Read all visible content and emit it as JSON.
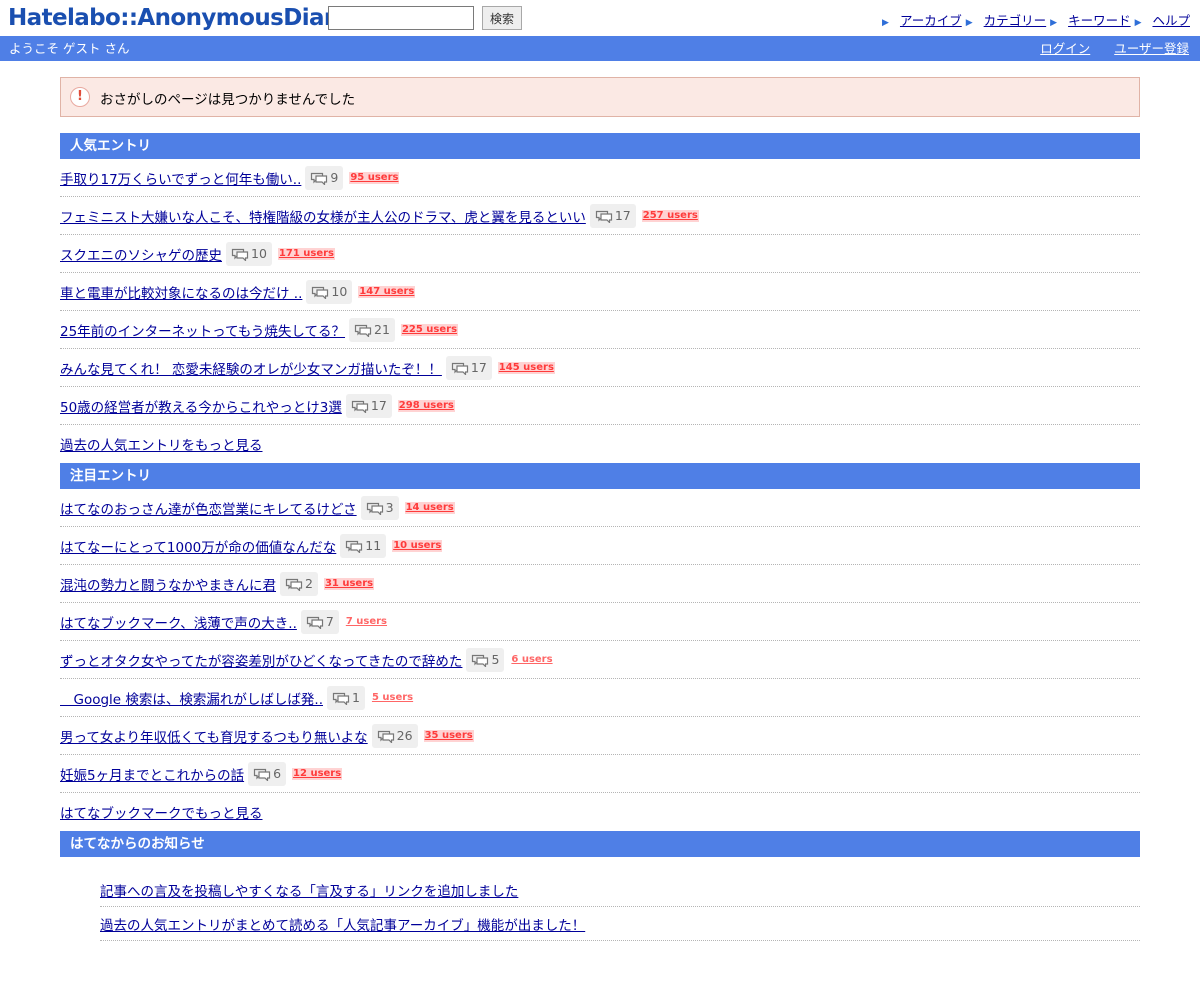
{
  "header": {
    "logo": "Hatelabo::AnonymousDiary",
    "search_placeholder": "",
    "search_button": "検索",
    "links": [
      "アーカイブ",
      "カテゴリー",
      "キーワード",
      "ヘルプ"
    ]
  },
  "userbar": {
    "welcome": "ようこそ ゲスト さん",
    "login": "ログイン",
    "register": "ユーザー登録"
  },
  "alert": {
    "icon": "!",
    "message": "おさがしのページは見つかりませんでした"
  },
  "popular": {
    "heading": "人気エントリ",
    "entries": [
      {
        "title": "手取り17万くらいでずっと何年も働い..",
        "comments": "9",
        "users": "95 users"
      },
      {
        "title": "フェミニスト大嫌いな人こそ、特権階級の女様が主人公のドラマ、虎と翼を見るといい",
        "comments": "17",
        "users": "257 users"
      },
      {
        "title": "スクエニのソシャゲの歴史",
        "comments": "10",
        "users": "171 users"
      },
      {
        "title": "車と電車が比較対象になるのは今だけ ..",
        "comments": "10",
        "users": "147 users"
      },
      {
        "title": "25年前のインターネットってもう焼失してる？",
        "comments": "21",
        "users": "225 users"
      },
      {
        "title": "みんな見てくれ！ 恋愛未経験のオレが少女マンガ描いたぞ！！",
        "comments": "17",
        "users": "145 users"
      },
      {
        "title": "50歳の経営者が教える今からこれやっとけ3選",
        "comments": "17",
        "users": "298 users"
      }
    ],
    "more": "過去の人気エントリをもっと見る"
  },
  "hot": {
    "heading": "注目エントリ",
    "entries": [
      {
        "title": "はてなのおっさん達が色恋営業にキレてるけどさ",
        "comments": "3",
        "users": "14 users",
        "light": false
      },
      {
        "title": "はてなーにとって1000万が命の価値なんだな",
        "comments": "11",
        "users": "10 users",
        "light": false
      },
      {
        "title": "混沌の勢力と闘うなかやまきんに君",
        "comments": "2",
        "users": "31 users",
        "light": false
      },
      {
        "title": "はてなブックマーク、浅薄で声の大き..",
        "comments": "7",
        "users": "7 users",
        "light": true
      },
      {
        "title": "ずっとオタク女やってたが容姿差別がひどくなってきたので辞めた",
        "comments": "5",
        "users": "6 users",
        "light": true
      },
      {
        "title": "　Google 検索は、検索漏れがしばしば発..",
        "comments": "1",
        "users": "5 users",
        "light": true
      },
      {
        "title": "男って女より年収低くても育児するつもり無いよな",
        "comments": "26",
        "users": "35 users",
        "light": false
      },
      {
        "title": "妊娠5ヶ月までとこれからの話",
        "comments": "6",
        "users": "12 users",
        "light": false
      }
    ],
    "more": "はてなブックマークでもっと見る"
  },
  "news": {
    "heading": "はてなからのお知らせ",
    "items": [
      "記事への言及を投稿しやすくなる「言及する」リンクを追加しました",
      "過去の人気エントリがまとめて読める「人気記事アーカイブ」機能が出ました！"
    ]
  },
  "colors": {
    "accent": "#4f7fe6",
    "link": "#000099",
    "users_red": "#ff3b3b",
    "alert_bg": "#fbe9e4"
  },
  "icons": {
    "comment": "speech-bubble-icon",
    "link_arrow": "triangle-right-icon",
    "alert": "exclamation-icon"
  }
}
